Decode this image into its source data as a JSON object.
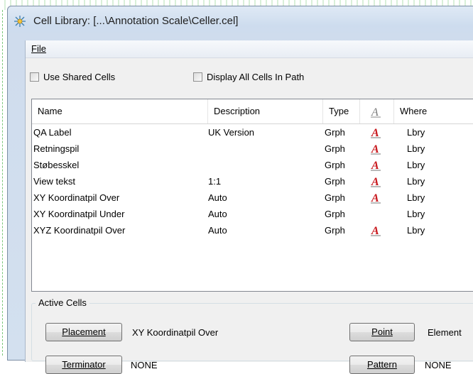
{
  "window": {
    "title": "Cell Library: [...\\Annotation Scale\\Celler.cel]",
    "icon": "cell-library-icon"
  },
  "menubar": {
    "file": "File"
  },
  "options": {
    "use_shared_cells": {
      "label": "Use Shared Cells",
      "checked": false
    },
    "display_all_cells": {
      "label": "Display All Cells In Path",
      "checked": false
    }
  },
  "list": {
    "columns": [
      "Name",
      "Description",
      "Type",
      "annotation-icon",
      "Where"
    ],
    "headers": {
      "name": "Name",
      "description": "Description",
      "type": "Type",
      "where": "Where"
    },
    "rows": [
      {
        "name": "QA Label",
        "description": "UK Version",
        "type": "Grph",
        "annotation": true,
        "where": "Lbry"
      },
      {
        "name": "Retningspil",
        "description": "",
        "type": "Grph",
        "annotation": true,
        "where": "Lbry"
      },
      {
        "name": "Støbesskel",
        "description": "",
        "type": "Grph",
        "annotation": true,
        "where": "Lbry"
      },
      {
        "name": "View tekst",
        "description": "1:1",
        "type": "Grph",
        "annotation": true,
        "where": "Lbry"
      },
      {
        "name": "XY Koordinatpil Over",
        "description": "Auto",
        "type": "Grph",
        "annotation": true,
        "where": "Lbry"
      },
      {
        "name": "XY Koordinatpil Under",
        "description": "Auto",
        "type": "Grph",
        "annotation": false,
        "where": "Lbry"
      },
      {
        "name": "XYZ Koordinatpil Over",
        "description": "Auto",
        "type": "Grph",
        "annotation": true,
        "where": "Lbry"
      }
    ]
  },
  "active_cells": {
    "label": "Active Cells",
    "placement_button": "Placement",
    "placement_value": "XY Koordinatpil Over",
    "terminator_button": "Terminator",
    "terminator_value": "NONE",
    "point_button": "Point",
    "point_value": "Element",
    "pattern_button": "Pattern",
    "pattern_value": "NONE"
  },
  "colors": {
    "annotation_red": "#c8191e",
    "accent": "#3c7fb1"
  }
}
